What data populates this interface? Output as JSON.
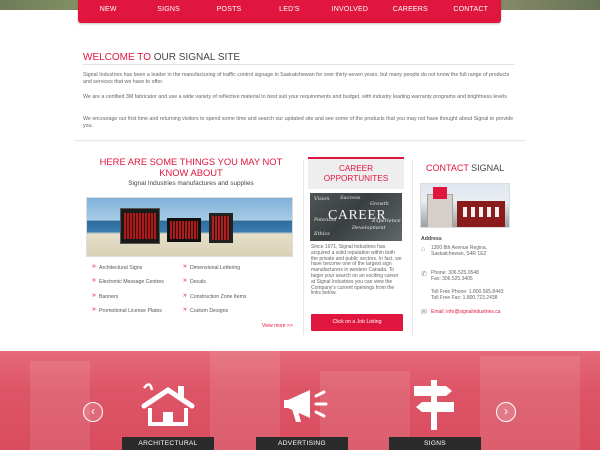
{
  "nav": {
    "items": [
      "NEW",
      "SIGNS",
      "POSTS",
      "LED'S",
      "INVOLVED",
      "CAREERS",
      "CONTACT"
    ]
  },
  "welcome": {
    "title_accent": "WELCOME TO",
    "title_rest": " OUR SIGNAL SITE",
    "paragraphs": [
      "Signal Industries has been a leader in the manufacturing of traffic control signage in Saskatchewan for over thirty-seven years, but many people do not know the full range of products and services that we have to offer.",
      "We are a certified 3M fabricator and use a wide variety of reflective material to best suit your requirements and budget, with industry leading warranty programs and brightness levels",
      "We encourage our first time and returning visitors to spend some time and search our updated site and see some of the products that you may not have thought about Signal to provide you."
    ]
  },
  "things": {
    "title": "HERE ARE SOME THINGS YOU MAY NOT KNOW ABOUT",
    "subtitle": "Signal Industries manufactures and supplies",
    "list_left": [
      "Architectural Signs",
      "Electronic Message Centres",
      "Banners",
      "Promotional License Plates"
    ],
    "list_right": [
      "Dimensional Lettering",
      "Decals",
      "Construction Zone Items",
      "Custom Designs"
    ],
    "view_more": "View more >>"
  },
  "career": {
    "title": "CAREER OPPORTUNITES",
    "image_words": [
      "Vision",
      "Growth",
      "Potential",
      "Development",
      "Ethics",
      "Experience",
      "Success"
    ],
    "image_big": "CAREER",
    "text": "Since 1971, Signal Industries has acquired a solid reputation within both the private and public sectors. In fact, we have become one of the largest sign manufacturers in western Canada. To begin your search on an exciting career at Signal Industries you can view the Company's current openings from the links below.",
    "button": "Click on a Job Listing"
  },
  "contact": {
    "title_accent": "CONTACT",
    "title_rest": " SIGNAL",
    "address_label": "Address",
    "address": "1300 8th Avenue Regina, Saskatchewan, S4R 1E2",
    "phone": "Phone: 306.525.0548",
    "fax": "Fax: 306.525.3405",
    "tollfree_phone": "Toll Free Phone: 1.800.565.8443",
    "tollfree_fax": "Toll Free Fax: 1.800.723.2438",
    "email": "Email: info@signalindustries.ca"
  },
  "categories": [
    "ARCHITECTURAL",
    "ADVERTISING",
    "SIGNS"
  ],
  "icons": {
    "prev": "chevron-left-icon",
    "next": "chevron-right-icon"
  }
}
